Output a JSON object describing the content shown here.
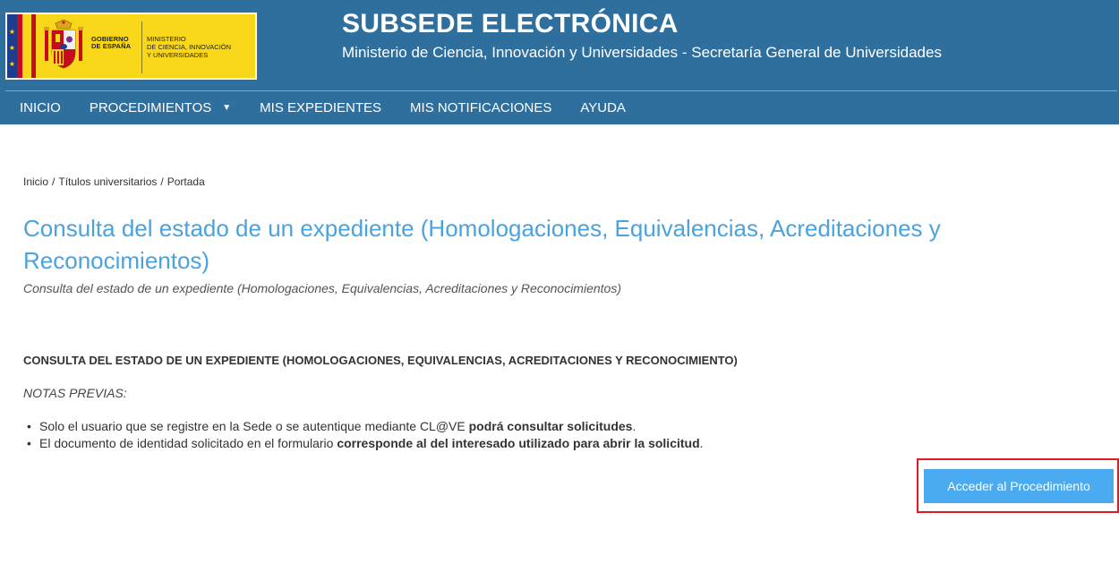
{
  "header": {
    "title": "SUBSEDE ELECTRÓNICA",
    "subtitle": "Ministerio de Ciencia, Innovación y Universidades - Secretaría General de Universidades",
    "logo": {
      "gobierno_line1": "GOBIERNO",
      "gobierno_line2": "DE ESPAÑA",
      "ministerio_line1": "MINISTERIO",
      "ministerio_line2": "DE CIENCIA, INNOVACIÓN",
      "ministerio_line3": "Y UNIVERSIDADES"
    },
    "bg_color": "#2f6f9e"
  },
  "nav": {
    "items": [
      {
        "label": "INICIO"
      },
      {
        "label": "PROCEDIMIENTOS",
        "has_dropdown": true
      },
      {
        "label": "MIS EXPEDIENTES"
      },
      {
        "label": "MIS NOTIFICACIONES"
      },
      {
        "label": "AYUDA"
      }
    ]
  },
  "breadcrumb": {
    "items": [
      "Inicio",
      "Títulos universitarios",
      "Portada"
    ],
    "separator": "/"
  },
  "main": {
    "title": "Consulta del estado de un expediente (Homologaciones, Equivalencias, Acreditaciones y Reconocimientos)",
    "subtitle": "Consulta del estado de un expediente (Homologaciones, Equivalencias, Acreditaciones y Reconocimientos)",
    "section_heading": "CONSULTA DEL ESTADO DE UN EXPEDIENTE (HOMOLOGACIONES, EQUIVALENCIAS, ACREDITACIONES Y RECONOCIMIENTO)",
    "notes_label": "NOTAS PREVIAS:",
    "notes": [
      {
        "text": "Solo el usuario que se registre en la Sede o se autentique mediante CL@VE ",
        "bold": "podrá consultar solicitudes",
        "tail": "."
      },
      {
        "text": "El documento de identidad solicitado en el formulario ",
        "bold": "corresponde al del interesado utilizado para abrir la solicitud",
        "tail": "."
      }
    ],
    "access_button": "Acceder al Procedimiento",
    "title_color": "#4aa3df",
    "button_color": "#4aabf0",
    "highlight_color": "#e01b24"
  }
}
